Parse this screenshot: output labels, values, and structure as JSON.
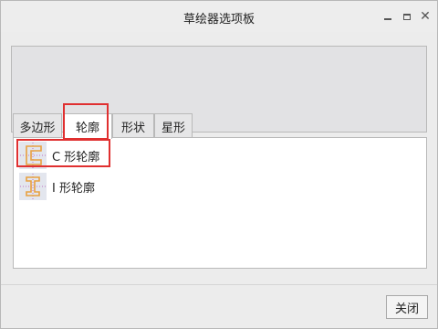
{
  "window": {
    "title": "草绘器选项板"
  },
  "tabs": [
    {
      "label": "多边形"
    },
    {
      "label": "轮廓"
    },
    {
      "label": "形状"
    },
    {
      "label": "星形"
    }
  ],
  "active_tab": "轮廓",
  "items": [
    {
      "label": "C 形轮廓",
      "icon": "c-profile-icon"
    },
    {
      "label": "I 形轮廓",
      "icon": "i-profile-icon"
    }
  ],
  "footer": {
    "close_label": "关闭"
  },
  "colors": {
    "highlight": "#e03030",
    "icon_orange": "#e8a040",
    "icon_dot": "#c070c0"
  }
}
